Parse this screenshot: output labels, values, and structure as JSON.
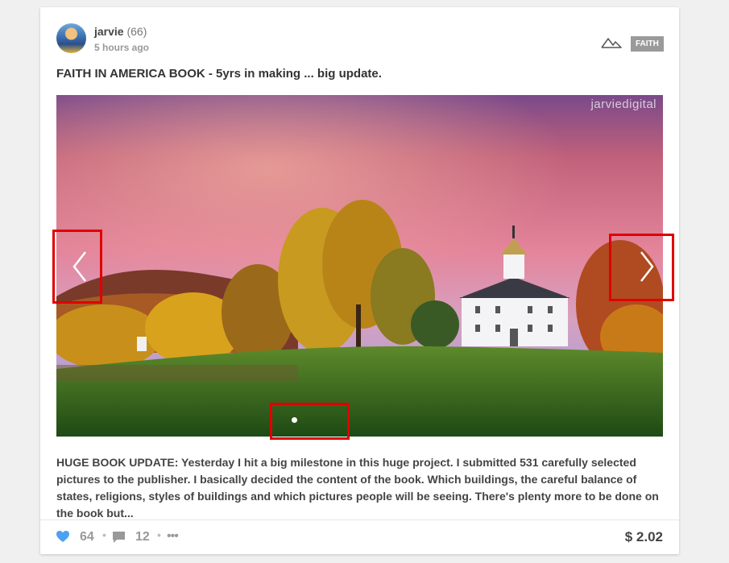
{
  "post": {
    "author": "jarvie",
    "reputation": "(66)",
    "time_ago": "5 hours ago",
    "tag": "FAITH",
    "title": "FAITH IN AMERICA BOOK - 5yrs in making ... big update.",
    "image_watermark": "jarviedigital",
    "body": "HUGE BOOK UPDATE: Yesterday I hit a big milestone in this huge project. I submitted 531 carefully selected pictures to the publisher. I basically decided the content of the book. Which buildings, the careful balance of states, religions, styles of buildings and which pictures people will be seeing. There's plenty more to be done on the book but..."
  },
  "footer": {
    "votes": "64",
    "comments": "12",
    "separator": "•",
    "more": "•••",
    "payout": "$ 2.02"
  },
  "icons": {
    "vote": "heart-icon",
    "comment": "comment-icon",
    "more": "more-icon",
    "community": "mountain-icon",
    "prev": "chevron-left-icon",
    "next": "chevron-right-icon"
  },
  "colors": {
    "highlight": "#e00000",
    "vote": "#4ba2f2"
  }
}
